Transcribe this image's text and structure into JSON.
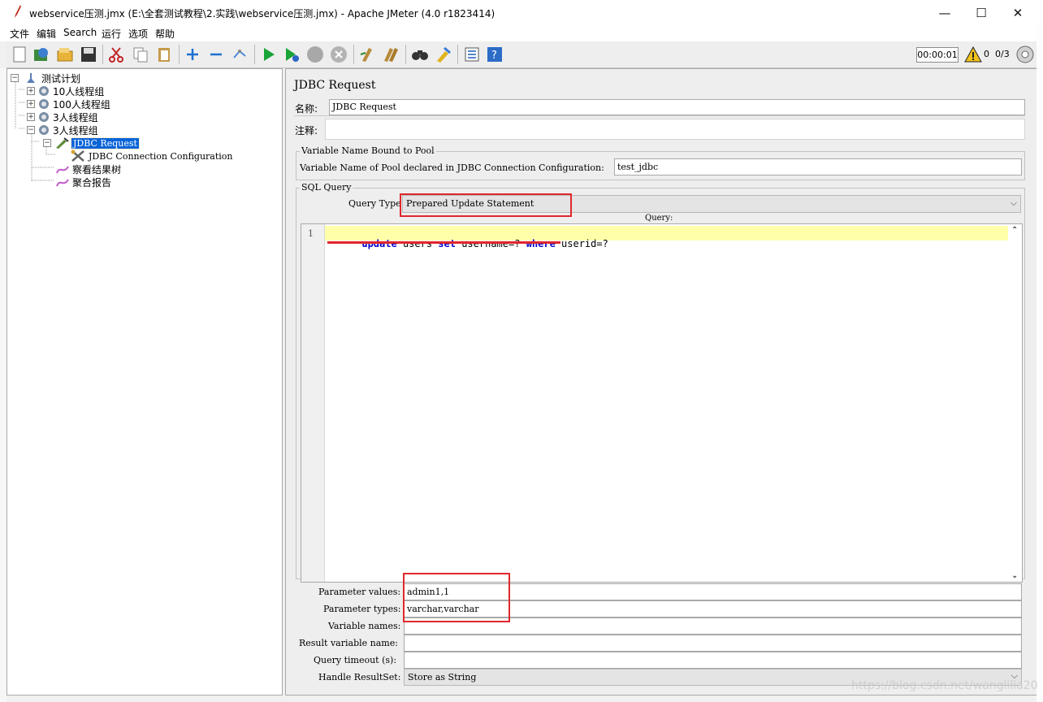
{
  "window": {
    "title": "webservice压测.jmx (E:\\全套测试教程\\2.实践\\webservice压测.jmx) - Apache JMeter (4.0 r1823414)",
    "minimize": "—",
    "maximize": "☐",
    "close": "✕"
  },
  "menu": [
    "文件",
    "编辑",
    "Search",
    "运行",
    "选项",
    "帮助"
  ],
  "toolbar": {
    "timer": "00:00:01",
    "warnings_count": "0",
    "threads": "0/3",
    "icons": [
      "new-icon",
      "templates-icon",
      "open-icon",
      "save-icon",
      "cut-icon",
      "copy-icon",
      "paste-icon",
      "expand-icon",
      "collapse-icon",
      "toggle-icon",
      "start-icon",
      "start-no-pause-icon",
      "stop-icon",
      "shutdown-icon",
      "clear-icon",
      "clear-all-icon",
      "search-icon",
      "reset-search-icon",
      "function-helper-icon",
      "help-icon"
    ]
  },
  "tree": {
    "root": "测试计划",
    "groups": [
      "10人线程组",
      "100人线程组",
      "3人线程组",
      "3人线程组"
    ],
    "selected": "JDBC Request",
    "config": "JDBC Connection Configuration",
    "listeners": [
      "察看结果树",
      "聚合报告"
    ]
  },
  "panel": {
    "heading": "JDBC Request",
    "name_label": "名称:",
    "name_value": "JDBC Request",
    "comment_label": "注释:",
    "comment_value": "",
    "pool_legend": "Variable Name Bound to Pool",
    "pool_label": "Variable Name of Pool declared in JDBC Connection Configuration:",
    "pool_value": "test_jdbc",
    "sql_legend": "SQL Query",
    "query_type_label": "Query Type",
    "query_type_value": "Prepared Update Statement",
    "query_label": "Query:",
    "line_number": "1",
    "query_tokens": {
      "kw1": "update",
      "t1": " users ",
      "kw2": "set",
      "t2": " username=? ",
      "kw3": "where",
      "t3": " userid=?"
    },
    "param_values_label": "Parameter values:",
    "param_values": "admin1,1",
    "param_types_label": "Parameter types:",
    "param_types": "varchar,varchar",
    "var_names_label": "Variable names:",
    "var_names": "",
    "result_var_label": "Result variable name:",
    "result_var": "",
    "timeout_label": "Query timeout (s):",
    "timeout": "",
    "resultset_label": "Handle ResultSet:",
    "resultset_value": "Store as String"
  },
  "watermark": "https://blog.csdn.net/wanglilia20",
  "colors": {
    "highlight_line": "#ffffaa",
    "annotation_red": "#e0272b",
    "keyword": "#0000cc",
    "selection": "#0a64d8"
  }
}
